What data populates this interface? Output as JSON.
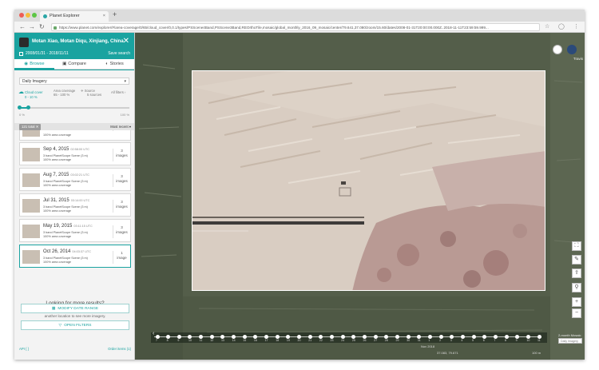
{
  "browser": {
    "tab_title": "Planet Explorer",
    "url": "https://www.planet.com/explorer/#/area-coverage/0/65/cloud_cover/0,0.1/types/PSScene4Band,PSScene3Band,REOrthoTile,mosaic/global_monthly_2016_09_mosaic/center/79.641,37.080/zoom/15.60/dates/2008-01-31T20:00:00.000Z..2018-11-11T23:59:59.999..."
  },
  "header": {
    "location": "Motan Xiao, Motan Diqu, Xinjiang, China",
    "date_range": "2008/01/31 - 2018/11/11",
    "save_search": "Save search",
    "tabs": [
      {
        "label": "Browse",
        "icon": "eye-icon"
      },
      {
        "label": "Compare",
        "icon": "compare-icon"
      },
      {
        "label": "Stories",
        "icon": "stories-icon"
      }
    ]
  },
  "filters": {
    "imagery_type": "Daily Imagery",
    "cloud_cover": "Cloud cover",
    "cloud_value": "0 - 10 %",
    "area_coverage": "Area coverage",
    "area_value": "65 - 100 %",
    "source": "Source",
    "source_value": "5 sources",
    "all_filters": "All filters",
    "range_min": "0 %",
    "range_max": "100 %"
  },
  "list": {
    "count_label": "121 total",
    "sort_label": "Most recent",
    "items": [
      {
        "date": "",
        "meta": "",
        "source": "",
        "coverage": "100% area coverage",
        "count": "",
        "count_unit": "images",
        "partial": true
      },
      {
        "date": "Sep 4, 2015",
        "meta": "02:58:00 UTC",
        "source": "3 band PlanetScope Scene (3 m)",
        "coverage": "100% area coverage",
        "count": "3",
        "count_unit": "images"
      },
      {
        "date": "Aug 7, 2015",
        "meta": "03:02:21 UTC",
        "source": "3 band PlanetScope Scene (3 m)",
        "coverage": "100% area coverage",
        "count": "3",
        "count_unit": "images"
      },
      {
        "date": "Jul 31, 2015",
        "meta": "03:14:00 UTC",
        "source": "3 band PlanetScope Scene (3 m)",
        "coverage": "100% area coverage",
        "count": "3",
        "count_unit": "images"
      },
      {
        "date": "May 19, 2015",
        "meta": "03:11:15 UTC",
        "source": "3 band PlanetScope Scene (3 m)",
        "coverage": "100% area coverage",
        "count": "3",
        "count_unit": "images"
      },
      {
        "date": "Oct 26, 2014",
        "meta": "04:03:37 UTC",
        "source": "3 band PlanetScope Scene (3 m)",
        "coverage": "100% area coverage",
        "count": "1",
        "count_unit": "image",
        "selected": true
      }
    ]
  },
  "more": {
    "title": "Looking for more results?",
    "body": "Try resetting your filters, extending your date range, or searching in another location to see more imagery.",
    "modify_date": "MODIFY DATE RANGE",
    "open_filters": "OPEN FILTERS"
  },
  "footer": {
    "api": "API { }",
    "order": "Order items (1)"
  },
  "map": {
    "top_right_label": "Travis",
    "timeline_numbers": [
      "7",
      "8",
      "9",
      "10",
      "11",
      "12",
      "13",
      "14",
      "15",
      "16",
      "17",
      "18",
      "19",
      "20",
      "21",
      "22",
      "23",
      "24",
      "25",
      "26",
      "27",
      "28",
      "29",
      "30",
      "31",
      "1",
      "2",
      "3",
      "4",
      "5",
      "6",
      "7",
      "8",
      "9",
      "10",
      "11"
    ],
    "timeline_month": "Nov 2018",
    "right_label": "2-month Mosaic",
    "imagery_input": "Daily Imagery",
    "status_coords": "37.083, 79.671",
    "status_scale": "100 m"
  },
  "colors": {
    "teal": "#1aa3a0",
    "scene": "#d8cbc0",
    "ground": "#545e4a"
  }
}
